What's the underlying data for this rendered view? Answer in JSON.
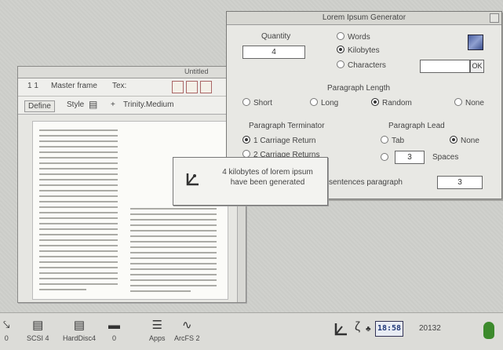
{
  "document_window": {
    "title": "Untitled",
    "ribbon1": {
      "num": "1 1",
      "master_frame": "Master frame",
      "text": "Tex:"
    },
    "ribbon2": {
      "define": "Define",
      "style": "Style",
      "plus": "+",
      "font": "Trinity.Medium"
    },
    "body_text_right": [
      "4 kilobytes of lorem ipsum",
      "have been generated"
    ]
  },
  "generator": {
    "title": "Lorem Ipsum Generator",
    "quantity_label": "Quantity",
    "quantity_value": "4",
    "unit_options": [
      {
        "label": "Words",
        "selected": false
      },
      {
        "label": "Kilobytes",
        "selected": true
      },
      {
        "label": "Characters",
        "selected": false
      }
    ],
    "ok_label": "OK",
    "paragraph_length": {
      "label": "Paragraph Length",
      "options": [
        {
          "label": "Short",
          "selected": false
        },
        {
          "label": "Long",
          "selected": false
        },
        {
          "label": "Random",
          "selected": true
        },
        {
          "label": "None",
          "selected": false
        }
      ]
    },
    "paragraph_terminator": {
      "label": "Paragraph Terminator",
      "options": [
        {
          "label": "1 Carriage Return",
          "selected": true
        },
        {
          "label": "2 Carriage Returns",
          "selected": false
        }
      ]
    },
    "paragraph_lead": {
      "label": "Paragraph Lead",
      "options": [
        {
          "label": "Tab",
          "selected": false
        },
        {
          "label": "None",
          "selected": true
        }
      ],
      "spaces_value": "3",
      "spaces_label": "Spaces"
    },
    "sentences_label": "sentences paragraph",
    "sentences_value": "3"
  },
  "info_box": {
    "line1": "4 kilobytes of lorem ipsum",
    "line2": "have been generated"
  },
  "iconbar": {
    "items": [
      {
        "label": "0",
        "icon": "floppy-drive-icon"
      },
      {
        "label": "SCSI 4",
        "icon": "scsi-drive-icon"
      },
      {
        "label": "HardDisc4",
        "icon": "hard-disc-icon"
      },
      {
        "label": "0",
        "icon": "ram-disc-icon"
      },
      {
        "label": "Apps",
        "icon": "apps-icon"
      },
      {
        "label": "ArcFS 2",
        "icon": "arcfs-icon"
      }
    ],
    "clock": "18:58",
    "memory": "20132",
    "colors": {
      "clock_text": "#223a7a",
      "frog": "#3c8a2c"
    }
  }
}
